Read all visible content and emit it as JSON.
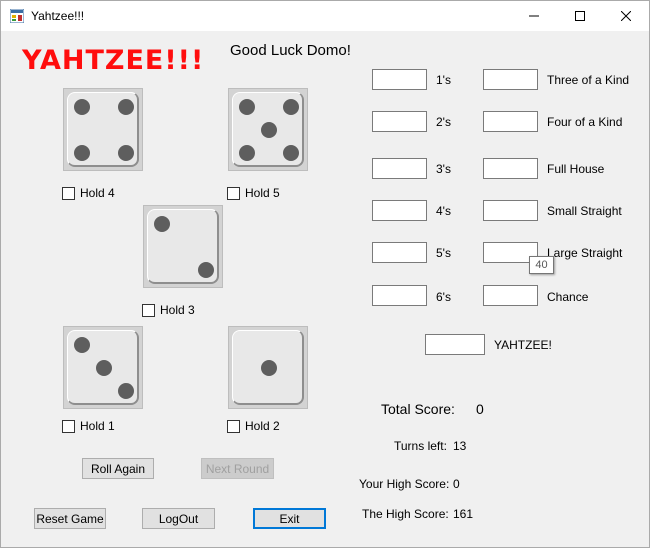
{
  "window": {
    "title": "Yahtzee!!!",
    "controls": {
      "minimize": "—",
      "maximize": "☐",
      "close": "✕"
    }
  },
  "logo_text": "YAHTZEE!!!",
  "greeting": "Good Luck Domo!",
  "dice": [
    {
      "id": 4,
      "value": 4,
      "hold_label": "Hold 4",
      "held": false
    },
    {
      "id": 5,
      "value": 5,
      "hold_label": "Hold 5",
      "held": false
    },
    {
      "id": 3,
      "value": 2,
      "hold_label": "Hold 3",
      "held": false
    },
    {
      "id": 1,
      "value": 3,
      "hold_label": "Hold 1",
      "held": false
    },
    {
      "id": 2,
      "value": 1,
      "hold_label": "Hold 2",
      "held": false
    }
  ],
  "buttons": {
    "roll_again": "Roll Again",
    "next_round": "Next Round",
    "reset_game": "Reset Game",
    "logout": "LogOut",
    "exit": "Exit"
  },
  "scorecard": {
    "upper": [
      {
        "label": "1's",
        "value": ""
      },
      {
        "label": "2's",
        "value": ""
      },
      {
        "label": "3's",
        "value": ""
      },
      {
        "label": "4's",
        "value": ""
      },
      {
        "label": "5's",
        "value": ""
      },
      {
        "label": "6's",
        "value": ""
      }
    ],
    "lower": [
      {
        "label": "Three of a Kind",
        "value": ""
      },
      {
        "label": "Four of a Kind",
        "value": ""
      },
      {
        "label": "Full House",
        "value": ""
      },
      {
        "label": "Small Straight",
        "value": ""
      },
      {
        "label": "Large Straight",
        "value": ""
      },
      {
        "label": "Chance",
        "value": ""
      }
    ],
    "yahtzee": {
      "label": "YAHTZEE!",
      "value": ""
    },
    "tooltip": "40"
  },
  "stats": {
    "total_score_label": "Total Score:",
    "total_score": "0",
    "turns_left_label": "Turns left:",
    "turns_left": "13",
    "your_high_score_label": "Your High Score:",
    "your_high_score": "0",
    "high_score_label": "The High Score:",
    "high_score": "161"
  },
  "colors": {
    "logo": "#ff0d0d",
    "pip": "#5e5e5e",
    "focus": "#0078d7"
  }
}
